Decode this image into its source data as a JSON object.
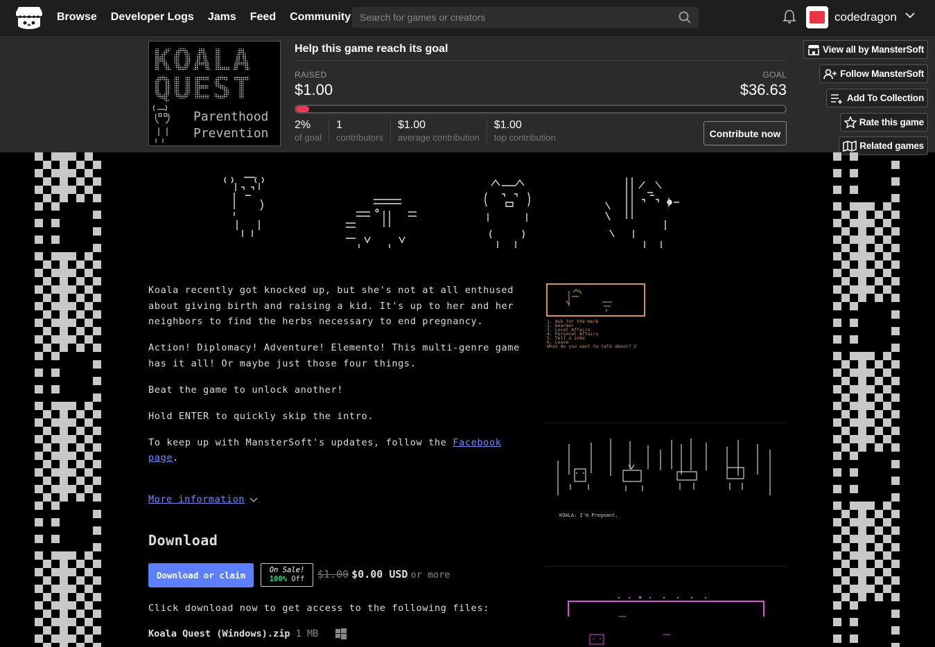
{
  "nav": {
    "links": [
      "Browse",
      "Developer Logs",
      "Jams",
      "Feed",
      "Community"
    ],
    "search_placeholder": "Search for games or creators",
    "username": "codedragon"
  },
  "goal": {
    "title": "Help this game reach its goal",
    "raised_label": "RAISED",
    "raised_value": "$1.00",
    "goal_label": "GOAL",
    "goal_value": "$36.63",
    "progress_percent": 2.7,
    "stats": [
      {
        "value": "2%",
        "label": "of goal"
      },
      {
        "value": "1",
        "label": "contributors"
      },
      {
        "value": "$1.00",
        "label": "average contribution"
      },
      {
        "value": "$1.00",
        "label": "top contribution"
      }
    ],
    "contribute_label": "Contribute now"
  },
  "actions": {
    "view_all": "View all by MansterSoft",
    "follow": "Follow MansterSoft",
    "collection": "Add To Collection",
    "rate": "Rate this game",
    "related": "Related games"
  },
  "cover": {
    "title_line1": "KOALA",
    "title_line2": "QUEST",
    "subtitle_line1": "Parenthood",
    "subtitle_line2": "Prevention"
  },
  "description": {
    "p1": "Koala recently got knocked up, but she's not at all enthused about giving birth and raising a kid. It's up to her and her neighbors to find the herbs necessary to end pregnancy.",
    "p2": "Action! Diplomacy! Adventure! Elemento! This multi-genre game has it all! Or maybe just those four things.",
    "p3": "Beat the game to unlock another!",
    "p4": "Hold ENTER to quickly skip the intro.",
    "p5_prefix": "To keep up with MansterSoft's updates, follow the ",
    "p5_link": "Facebook page",
    "p5_suffix": "."
  },
  "more_info": "More information",
  "download": {
    "heading": "Download",
    "button": "Download or claim",
    "sale_line1": "On Sale!",
    "sale_pct": "100%",
    "sale_off": "Off",
    "old_price": "$1.00",
    "new_price": "$0.00 USD",
    "or_more": "or more",
    "files_text": "Click download now to get access to the following files:",
    "file_name": "Koala Quest (Windows).zip",
    "file_size": "1 MB"
  },
  "screenshots": {
    "shot2_caption": "KOALA: I'm Pregnant.",
    "shot1_menu": [
      "1. Ask for the Herb",
      "2. Dearmer",
      "3. Local Affairs",
      "4. Personal Affairs",
      "5. Tell a Joke",
      "6. Leave",
      "What do you want to talk about? 2"
    ]
  }
}
